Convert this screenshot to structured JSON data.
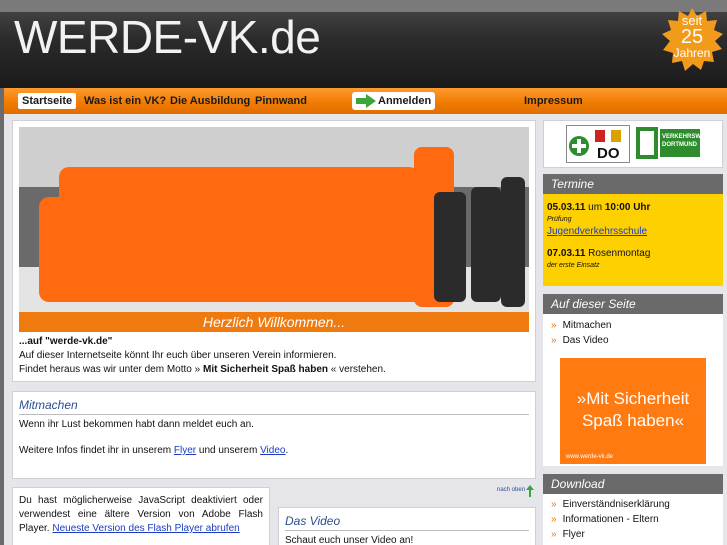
{
  "header": {
    "site_title": "WERDE-VK.de",
    "badge": {
      "line1": "seit",
      "line2": "25",
      "line3": "Jahren"
    }
  },
  "nav": {
    "items": [
      "Startseite",
      "Was ist ein VK?",
      "Die Ausbildung",
      "Pinnwand"
    ],
    "login": "Anmelden",
    "impressum": "Impressum"
  },
  "intro": {
    "welcome": "Herzlich Willkommen...",
    "heading": "...auf \"werde-vk.de\"",
    "line1": "Auf dieser Internetseite könnt Ihr euch über unseren Verein informieren.",
    "line2_prefix": "Findet heraus was wir unter dem Motto »",
    "line2_bold": "Mit Sicherheit Spaß haben",
    "line2_suffix": "« verstehen."
  },
  "mitmachen": {
    "title": "Mitmachen",
    "text1": "Wenn ihr Lust bekommen habt dann meldet euch an.",
    "text2_prefix": "Weitere Infos findet ihr in unserem",
    "flyer_link": "Flyer",
    "text2_mid": "und unserem",
    "video_link": "Video",
    "text2_suffix": ".",
    "top_link": "nach oben"
  },
  "flash": {
    "text": "Du hast möglicherweise JavaScript deaktiviert oder verwendest eine ältere Version von Adobe Flash Player.",
    "link": "Neueste Version des Flash Player abrufen"
  },
  "video": {
    "title": "Das Video",
    "text": "Schaut euch unser Video an!"
  },
  "sidebar": {
    "logo_text": "DO",
    "logo2_text": "VERKEHRSWACHT DORTMUND",
    "termine_title": "Termine",
    "events": [
      {
        "date": "05.03.11",
        "connector": "um",
        "time": "10:00 Uhr",
        "type": "Prüfung",
        "place": "Jugendverkehrsschule"
      },
      {
        "date": "07.03.11",
        "title": "Rosenmontag",
        "note": "der erste Einsatz"
      }
    ],
    "on_page_title": "Auf dieser Seite",
    "on_page_items": [
      "Mitmachen",
      "Das Video"
    ],
    "ad": {
      "line1": "»Mit Sicherheit",
      "line2": "Spaß haben«",
      "url": "www.werde-vk.de"
    },
    "download_title": "Download",
    "download_items": [
      "Einverständniserklärung",
      "Informationen - Eltern",
      "Flyer"
    ]
  },
  "colors": {
    "accent": "#f07a00",
    "termine_bg": "#ffd000",
    "link": "#1a3cc4",
    "heading": "#2a4e8f"
  }
}
